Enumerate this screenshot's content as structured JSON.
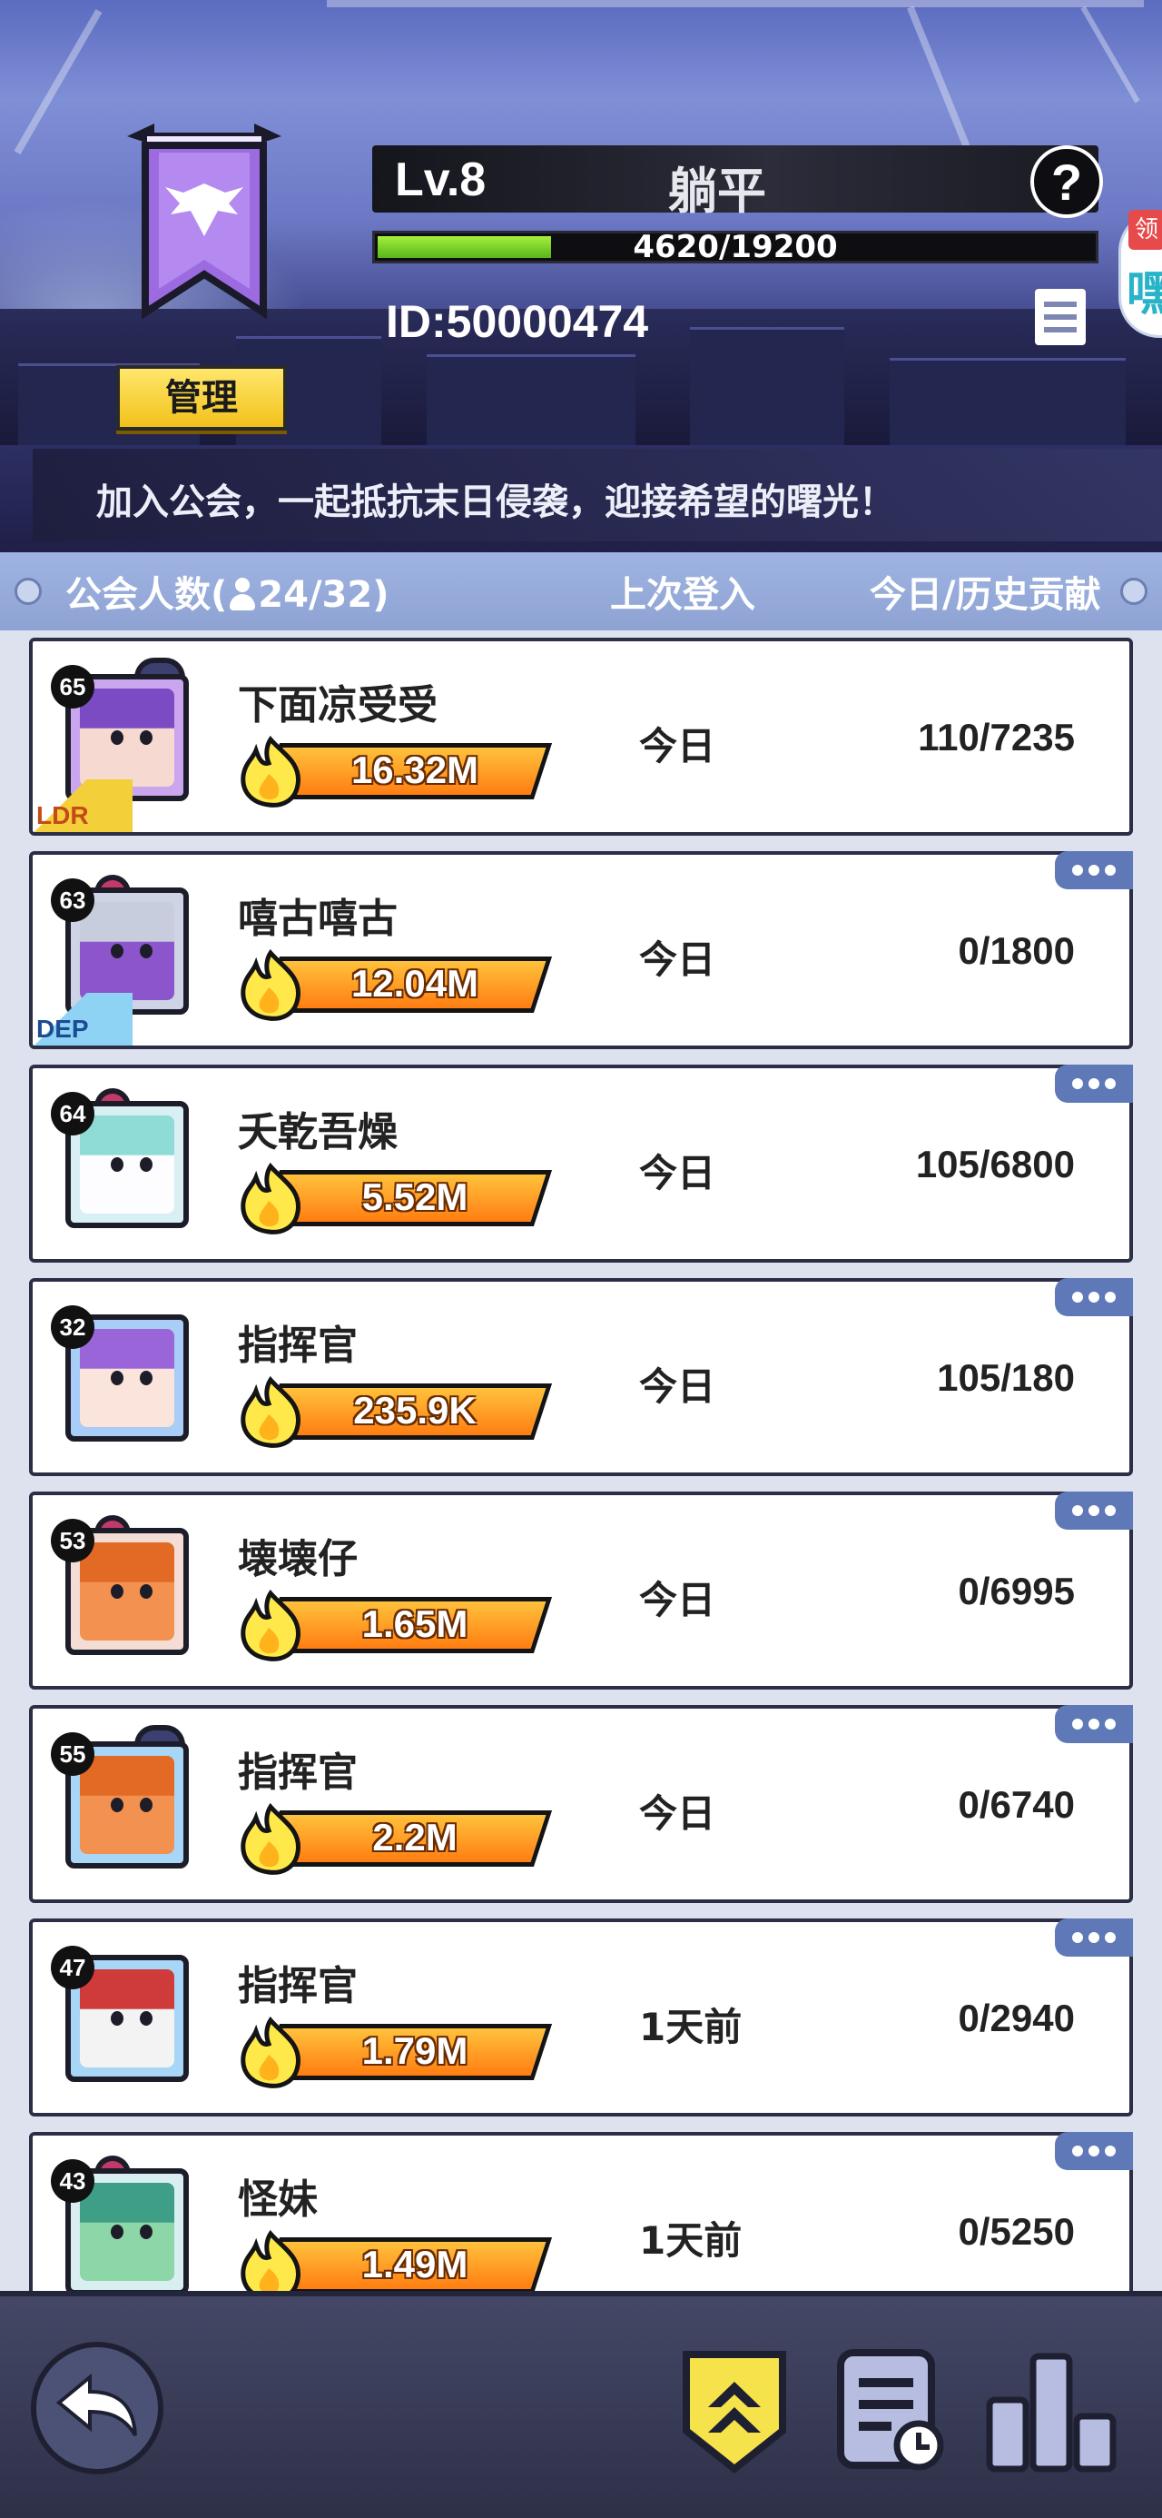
{
  "guild": {
    "level": "Lv.8",
    "name": "躺平",
    "help": "?",
    "xp_text": "4620/19200",
    "xp_fraction": 0.24,
    "id_text": "ID:50000474",
    "manage_label": "管理",
    "slogan": "加入公会，一起抵抗末日侵袭，迎接希望的曙光！",
    "side_bubble": {
      "tag": "领",
      "text": "嘿"
    }
  },
  "columns": {
    "members_prefix": "公会人数(",
    "members_count": "24/32)",
    "last_login": "上次登入",
    "contribution": "今日/历史贡献"
  },
  "members": [
    {
      "level": "65",
      "name": "下面凉受受",
      "power": "16.32M",
      "login": "今日",
      "contrib": "110/7235",
      "rank": "LDR",
      "avatar": "purple-hair-mecha"
    },
    {
      "level": "63",
      "name": "嘻古嘻古",
      "power": "12.04M",
      "login": "今日",
      "contrib": "0/1800",
      "rank": "DEP",
      "avatar": "purple-helmet-demon"
    },
    {
      "level": "64",
      "name": "夭乾吾燥",
      "power": "5.52M",
      "login": "今日",
      "contrib": "105/6800",
      "rank": "",
      "avatar": "cyan-boy-demon"
    },
    {
      "level": "32",
      "name": "指挥官",
      "power": "235.9K",
      "login": "今日",
      "contrib": "105/180",
      "rank": "",
      "avatar": "purple-hair-girl"
    },
    {
      "level": "53",
      "name": "壊壊仔",
      "power": "1.65M",
      "login": "今日",
      "contrib": "0/6995",
      "rank": "",
      "avatar": "orange-hood-demon"
    },
    {
      "level": "55",
      "name": "指挥官",
      "power": "2.2M",
      "login": "今日",
      "contrib": "0/6740",
      "rank": "",
      "avatar": "orange-hood-mecha"
    },
    {
      "level": "47",
      "name": "指挥官",
      "power": "1.79M",
      "login": "1天前",
      "contrib": "0/2940",
      "rank": "",
      "avatar": "red-knight-helmet"
    },
    {
      "level": "43",
      "name": "怪妹",
      "power": "1.49M",
      "login": "1天前",
      "contrib": "0/5250",
      "rank": "",
      "avatar": "green-goggles-demon"
    }
  ],
  "footer": {
    "back": "back-arrow-icon",
    "tabs": [
      "guild-rank-icon",
      "log-clock-icon",
      "stats-bars-icon"
    ]
  },
  "colors": {
    "accent_yellow": "#f2c21b",
    "power_orange": "#ff7d12",
    "xp_green": "#7fd62a",
    "more_blue": "#5e78b8"
  }
}
